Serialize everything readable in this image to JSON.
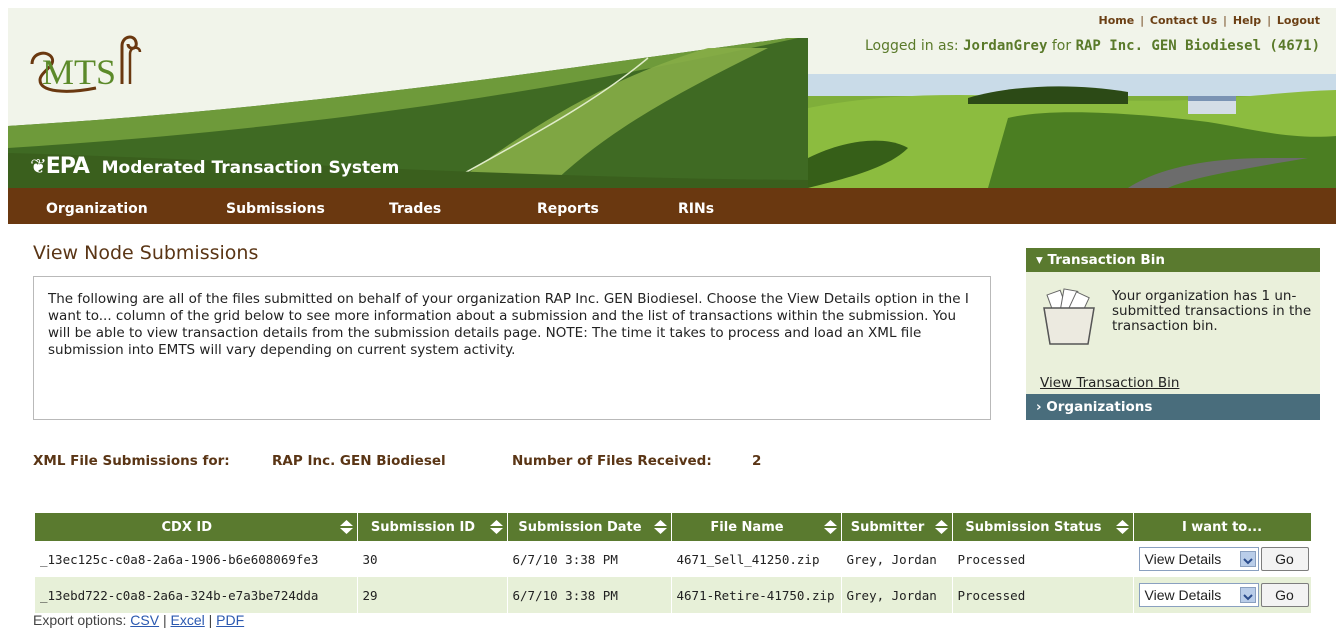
{
  "header": {
    "links": [
      "Home",
      "Contact Us",
      "Help",
      "Logout"
    ],
    "login_prefix": "Logged in as:",
    "user": "JordanGrey",
    "for_word": "for",
    "org": "RAP Inc. GEN Biodiesel (4671)",
    "epa_logo": "EPA",
    "system_title": "Moderated Transaction System"
  },
  "nav": [
    "Organization",
    "Submissions",
    "Trades",
    "Reports",
    "RINs"
  ],
  "page": {
    "title": "View Node Submissions",
    "info": "The following are all of the files submitted on behalf of your organization RAP Inc. GEN Biodiesel. Choose the View Details option in the I want to... column of the grid below to see more information about a submission and the list of transactions within the submission. You will be able to view transaction details from the submission details page. NOTE: The time it takes to process and load an XML file submission into EMTS will vary depending on current system activity."
  },
  "sidebar": {
    "bin_title": "Transaction Bin",
    "bin_text": "Your organization has 1 un-submitted transactions in the transaction bin.",
    "bin_link": "View Transaction Bin",
    "orgs_title": "Organizations"
  },
  "summary": {
    "label": "XML File Submissions for:",
    "org": "RAP Inc. GEN Biodiesel",
    "count_label": "Number of Files Received:",
    "count": "2"
  },
  "grid": {
    "columns": [
      "CDX ID",
      "Submission ID",
      "Submission Date",
      "File Name",
      "Submitter",
      "Submission Status",
      "I want to..."
    ],
    "rows": [
      {
        "cdx_id": "_13ec125c-c0a8-2a6a-1906-b6e608069fe3",
        "sub_id": "30",
        "date": "6/7/10 3:38 PM",
        "file": "4671_Sell_41250.zip",
        "submitter": "Grey, Jordan",
        "status": "Processed",
        "action": "View Details",
        "go": "Go"
      },
      {
        "cdx_id": "_13ebd722-c0a8-2a6a-324b-e7a3be724dda",
        "sub_id": "29",
        "date": "6/7/10 3:38 PM",
        "file": "4671-Retire-41750.zip",
        "submitter": "Grey, Jordan",
        "status": "Processed",
        "action": "View Details",
        "go": "Go"
      }
    ]
  },
  "export": {
    "label": "Export options:",
    "options": [
      "CSV",
      "Excel",
      "PDF"
    ]
  }
}
